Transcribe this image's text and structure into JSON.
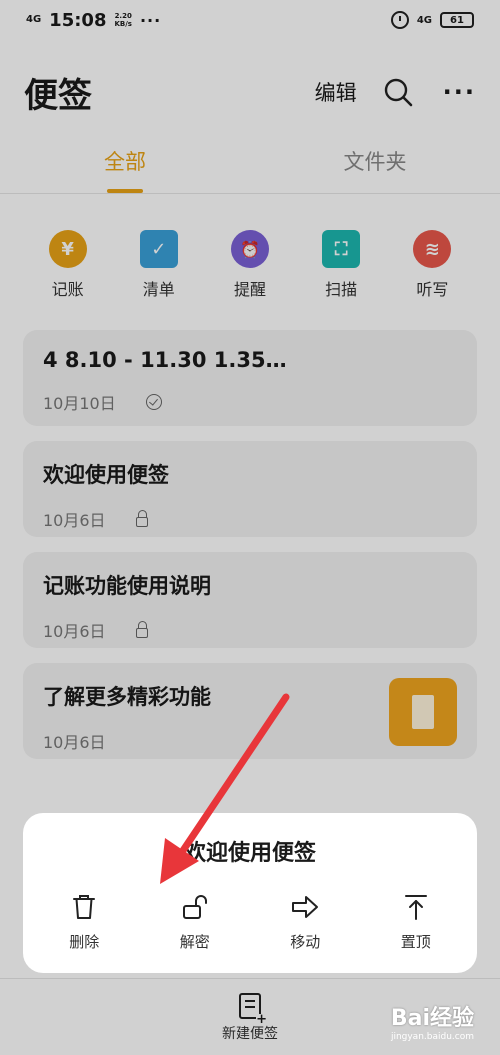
{
  "status_bar": {
    "signal": "4G",
    "time": "15:08",
    "speed_value": "2.20",
    "speed_unit": "KB/s",
    "more": "···",
    "network": "4G",
    "battery": "61"
  },
  "header": {
    "title": "便签",
    "edit_label": "编辑"
  },
  "tabs": [
    {
      "label": "全部",
      "active": true
    },
    {
      "label": "文件夹",
      "active": false
    }
  ],
  "quick_actions": [
    {
      "label": "记账",
      "icon": "yen-icon",
      "color": "#e8a317",
      "glyph": "¥"
    },
    {
      "label": "清单",
      "icon": "checklist-icon",
      "color": "#3aa0d8",
      "glyph": "✓"
    },
    {
      "label": "提醒",
      "icon": "alarm-icon",
      "color": "#7b61d6",
      "glyph": "⏰"
    },
    {
      "label": "扫描",
      "icon": "scan-icon",
      "color": "#1db8b0",
      "glyph": "⛶"
    },
    {
      "label": "听写",
      "icon": "voice-icon",
      "color": "#e8574b",
      "glyph": "≋"
    }
  ],
  "notes": [
    {
      "title": "4  8.10 - 11.30   1.35…",
      "date": "10月10日",
      "status_icon": "check-icon"
    },
    {
      "title": "欢迎使用便签",
      "date": "10月6日",
      "status_icon": "lock-icon"
    },
    {
      "title": "记账功能使用说明",
      "date": "10月6日",
      "status_icon": "lock-icon"
    },
    {
      "title": "了解更多精彩功能",
      "date": "10月6日",
      "status_icon": ""
    }
  ],
  "action_sheet": {
    "title": "欢迎使用便签",
    "actions": [
      {
        "label": "删除",
        "icon": "trash-icon"
      },
      {
        "label": "解密",
        "icon": "unlock-icon"
      },
      {
        "label": "移动",
        "icon": "move-arrow-icon"
      },
      {
        "label": "置顶",
        "icon": "pin-top-icon"
      }
    ]
  },
  "bottom_bar": {
    "new_note_label": "新建便签"
  },
  "watermark": {
    "logo": "Bai经验",
    "url": "jingyan.baidu.com"
  },
  "colors": {
    "accent": "#e8a317",
    "annotation_arrow": "#e8363a",
    "thumb": "#f0a51f"
  }
}
